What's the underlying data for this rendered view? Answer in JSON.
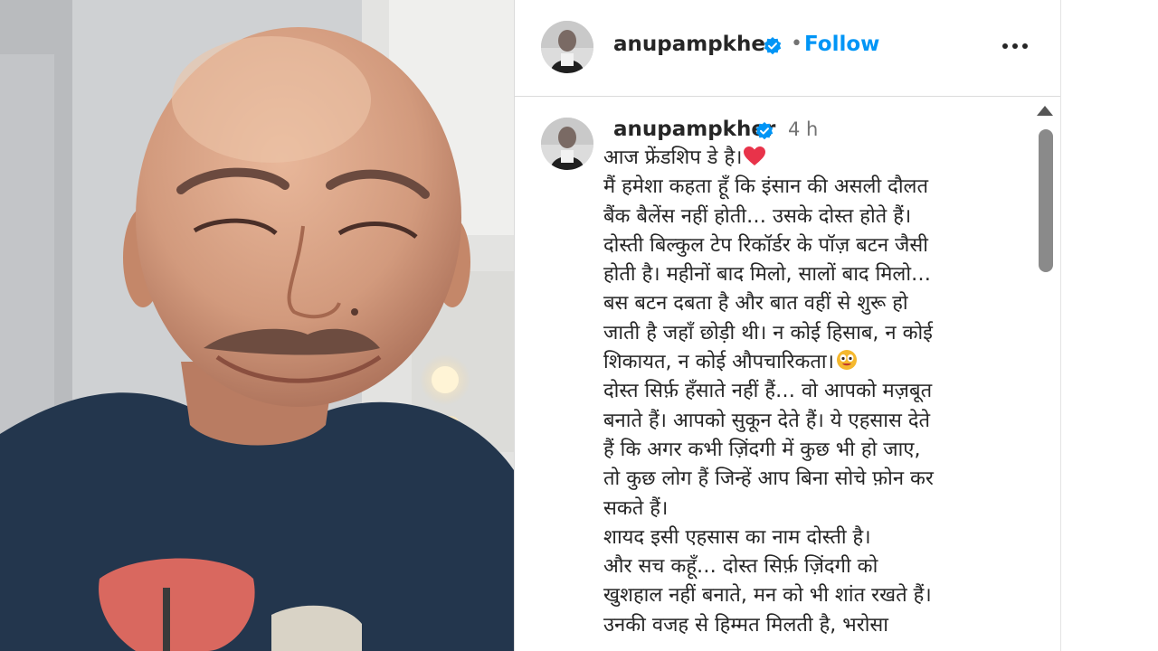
{
  "post": {
    "username": "anupampkher",
    "follow_label": "Follow",
    "separator": "•",
    "time": "4 h",
    "caption_lines": [
      "आज फ्रेंडशिप डे है।",
      "मैं हमेशा कहता हूँ कि इंसान की असली दौलत",
      "बैंक बैलेंस नहीं होती… उसके दोस्त होते हैं।",
      "दोस्ती बिल्कुल टेप रिकॉर्डर के पॉज़ बटन जैसी",
      "होती है। महीनों बाद मिलो, सालों बाद मिलो…",
      "बस बटन दबता है और बात वहीं से शुरू हो",
      "जाती है जहाँ छोड़ी थी। न कोई हिसाब, न कोई",
      "शिकायत, न कोई औपचारिकता।",
      "दोस्त सिर्फ़ हँसाते नहीं हैं… वो आपको मज़बूत",
      "बनाते हैं। आपको सुकून देते हैं। ये एहसास देते",
      "हैं कि अगर कभी ज़िंदगी में कुछ भी हो जाए,",
      "तो कुछ लोग हैं जिन्हें आप बिना सोचे फ़ोन कर",
      "सकते हैं।",
      "शायद इसी एहसास का नाम दोस्ती है।",
      "और सच कहूँ… दोस्त सिर्फ़ ज़िंदगी को",
      "खुशहाल नहीं बनाते, मन को भी शांत रखते हैं।",
      "उनकी वजह से हिम्मत मिलती है, भरोसा"
    ]
  },
  "icons": {
    "verified": "verified-badge-icon",
    "more": "more-options-icon",
    "heart_emoji": "heart-emoji-icon",
    "face_emoji": "grinning-face-emoji-icon"
  },
  "colors": {
    "link": "#0095f6",
    "verified": "#0095f6",
    "text": "#262626",
    "muted": "#737373",
    "heart": "#e8334a"
  }
}
